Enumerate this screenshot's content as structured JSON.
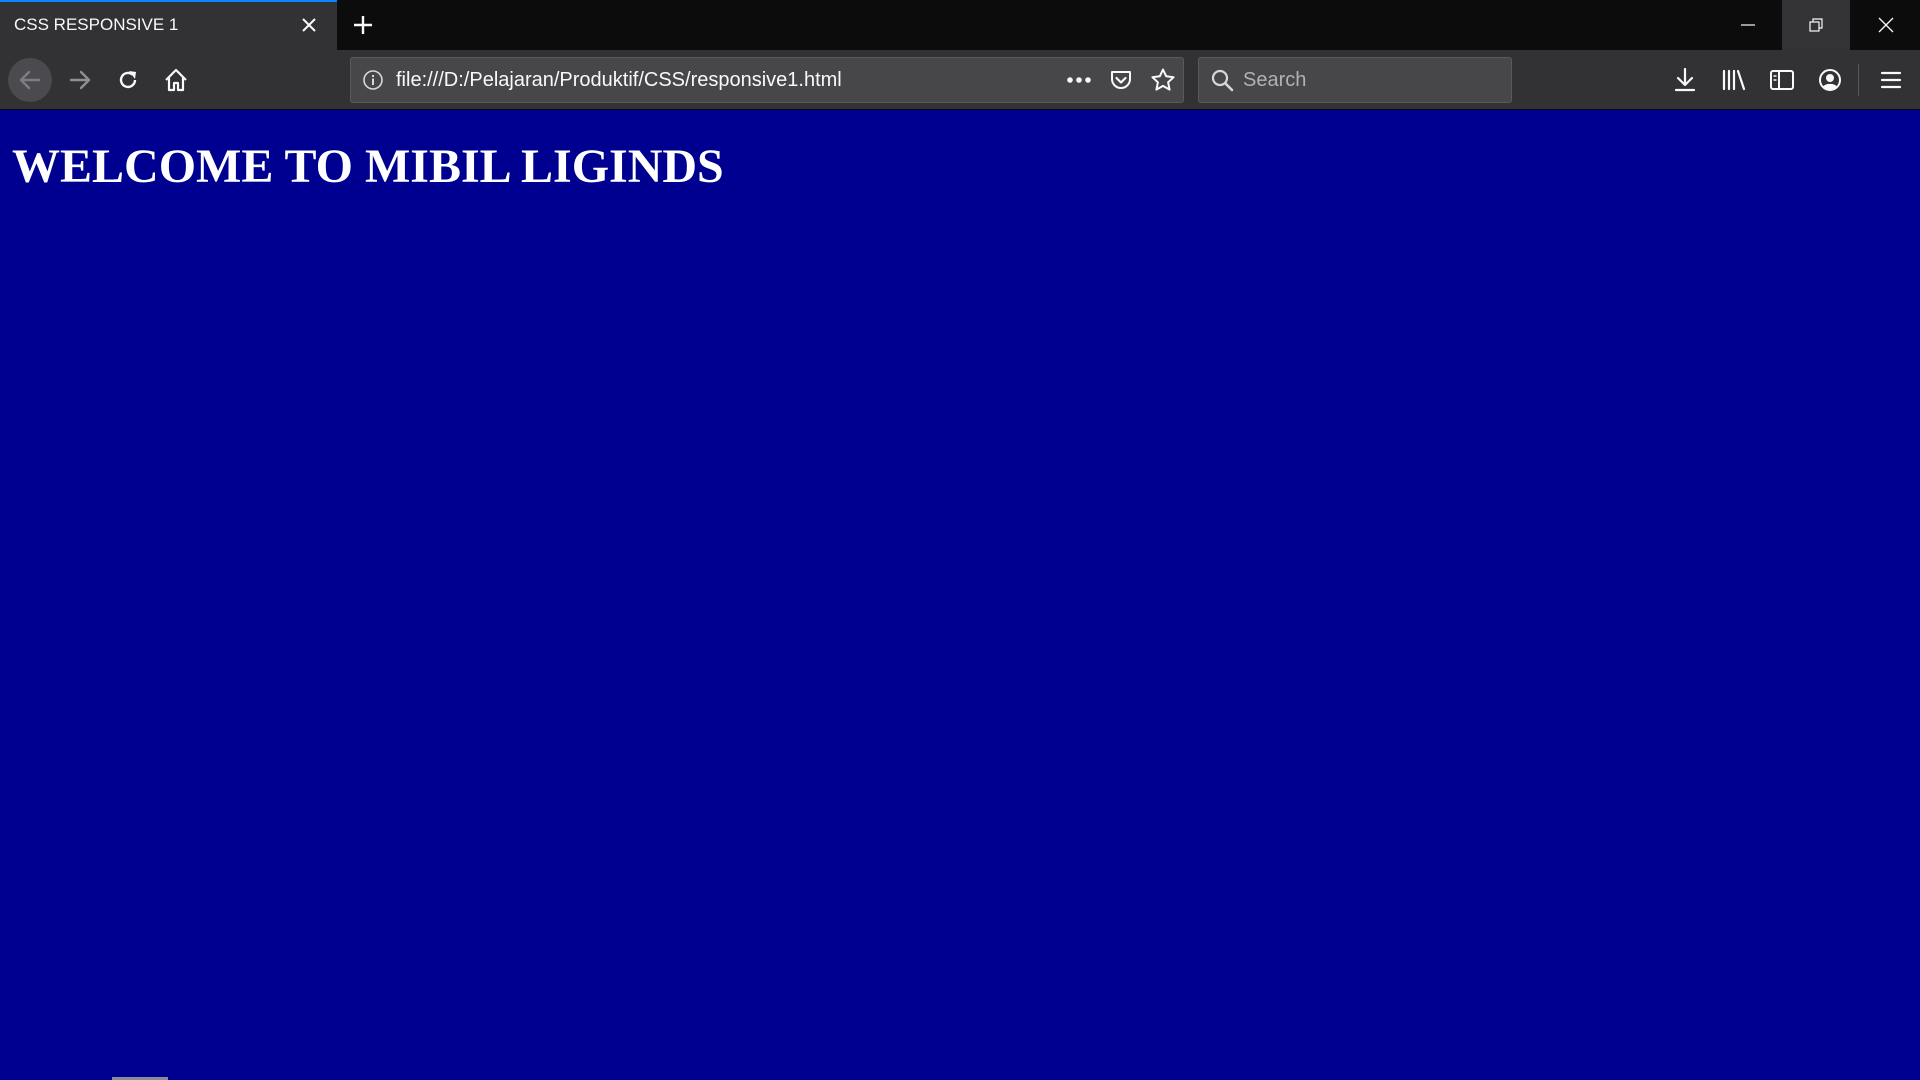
{
  "tab": {
    "title": "CSS RESPONSIVE 1"
  },
  "icons": {
    "tab_close": "close-icon",
    "new_tab": "plus-icon",
    "minimize": "minimize-icon",
    "restore": "restore-icon",
    "window_close": "close-icon",
    "back": "arrow-left-icon",
    "forward": "arrow-right-icon",
    "reload": "reload-icon",
    "home": "home-icon",
    "site_info": "info-icon",
    "page_actions": "more-horizontal-icon",
    "pocket": "pocket-icon",
    "bookmark": "star-icon",
    "search": "search-icon",
    "downloads": "download-icon",
    "library": "library-icon",
    "sidebar": "sidebar-icon",
    "account": "account-icon",
    "menu": "hamburger-menu-icon"
  },
  "urlbar": {
    "url": "file:///D:/Pelajaran/Produktif/CSS/responsive1.html"
  },
  "search": {
    "placeholder": "Search",
    "value": ""
  },
  "page": {
    "heading": "WELCOME TO MIBIL LIGINDS"
  },
  "colors": {
    "page_background": "#000090",
    "heading_text": "#ffffff",
    "tab_accent": "#0a84ff",
    "toolbar": "#323234",
    "titlebar": "#0c0c0d"
  }
}
